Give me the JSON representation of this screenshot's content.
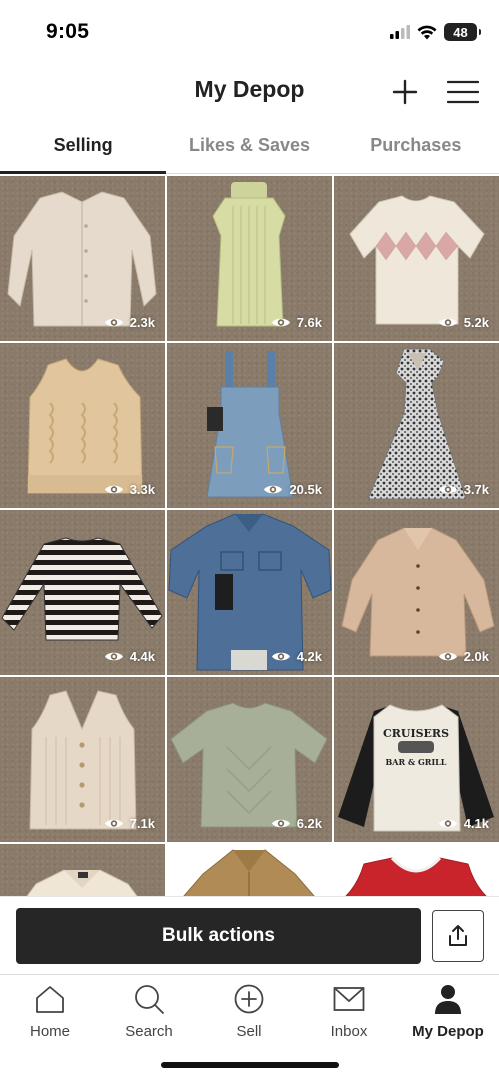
{
  "status": {
    "time": "9:05",
    "battery": "48",
    "icons": [
      "signal-icon",
      "wifi-icon",
      "battery-icon"
    ]
  },
  "header": {
    "title": "My Depop",
    "add_icon": "plus-icon",
    "menu_icon": "hamburger-menu-icon"
  },
  "tabs": [
    {
      "label": "Selling",
      "active": true
    },
    {
      "label": "Likes & Saves",
      "active": false
    },
    {
      "label": "Purchases",
      "active": false
    }
  ],
  "listings": [
    {
      "views": "2.3k",
      "item": "cream button-up cardigan"
    },
    {
      "views": "7.6k",
      "item": "green ribbed turtleneck sweater dress"
    },
    {
      "views": "5.2k",
      "item": "argyle short-sleeve sweater"
    },
    {
      "views": "3.3k",
      "item": "tan cable knit sweater vest"
    },
    {
      "views": "20.5k",
      "item": "denim overall dress"
    },
    {
      "views": "3.7k",
      "item": "black and white print maxi dress"
    },
    {
      "views": "4.4k",
      "item": "black and white striped top"
    },
    {
      "views": "4.2k",
      "item": "denim button-up shirt"
    },
    {
      "views": "2.0k",
      "item": "tan button-up blouse"
    },
    {
      "views": "7.1k",
      "item": "beige ribbed button vest"
    },
    {
      "views": "6.2k",
      "item": "sage green knit tee"
    },
    {
      "views": "4.1k",
      "item": "Cruisers Bar & Grill raglan tee"
    },
    {
      "views": "",
      "item": "cream collared shirt"
    },
    {
      "views": "",
      "item": "tan corduroy jacket"
    },
    {
      "views": "",
      "item": "red sleeveless jersey"
    }
  ],
  "listing_print": {
    "cruisers_line1": "CRUISERS",
    "cruisers_line2": "BAR & GRILL"
  },
  "actions": {
    "bulk_label": "Bulk actions",
    "share_icon": "share-upload-icon"
  },
  "nav": [
    {
      "label": "Home",
      "icon": "home-icon",
      "active": false
    },
    {
      "label": "Search",
      "icon": "search-icon",
      "active": false
    },
    {
      "label": "Sell",
      "icon": "plus-circle-icon",
      "active": false
    },
    {
      "label": "Inbox",
      "icon": "envelope-icon",
      "active": false
    },
    {
      "label": "My Depop",
      "icon": "profile-icon",
      "active": true
    }
  ],
  "colors": {
    "primary": "#262626",
    "carpet": "#8a7a69",
    "inactive_tab": "#888888"
  }
}
